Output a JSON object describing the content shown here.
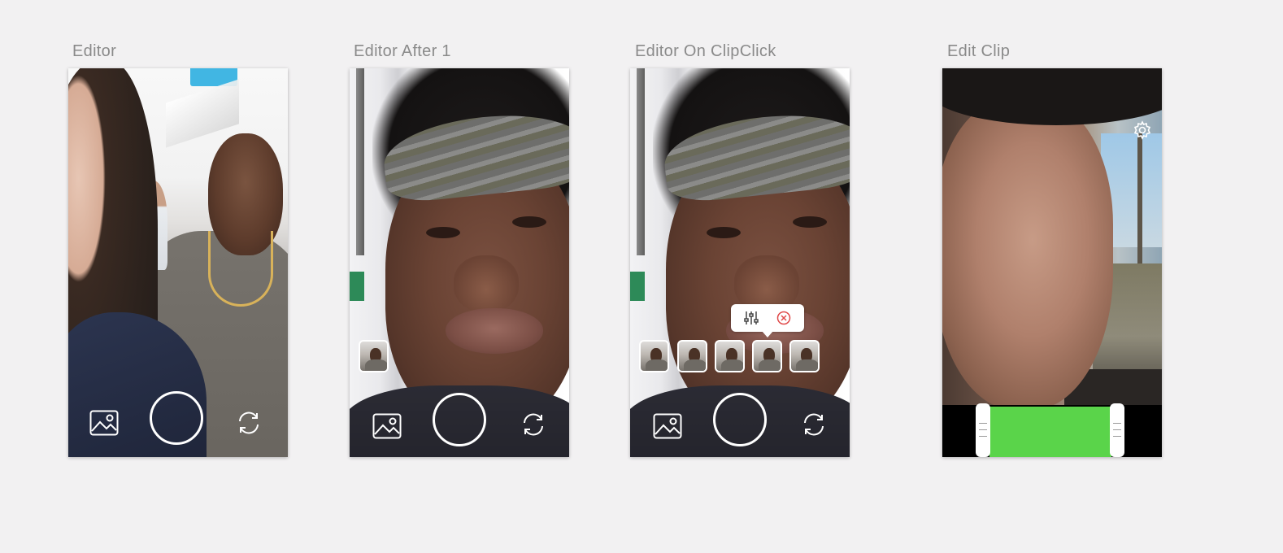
{
  "artboards": [
    {
      "title": "Editor"
    },
    {
      "title": "Editor After 1"
    },
    {
      "title": "Editor On ClipClick"
    },
    {
      "title": "Edit Clip"
    }
  ],
  "icons": {
    "gallery": "image-gallery-icon",
    "capture": "record-circle",
    "flip": "camera-flip-icon",
    "adjust": "sliders-icon",
    "delete": "close-circle-icon",
    "settings": "gear-icon"
  },
  "colors": {
    "background": "#f2f1f2",
    "label": "#8a8a8a",
    "control": "#ffffff",
    "delete_accent": "#e04a4a",
    "trim_range": "#5ad44a",
    "trim_bar": "#000000"
  },
  "clips": {
    "after_one_count": 1,
    "on_click_count": 5
  }
}
